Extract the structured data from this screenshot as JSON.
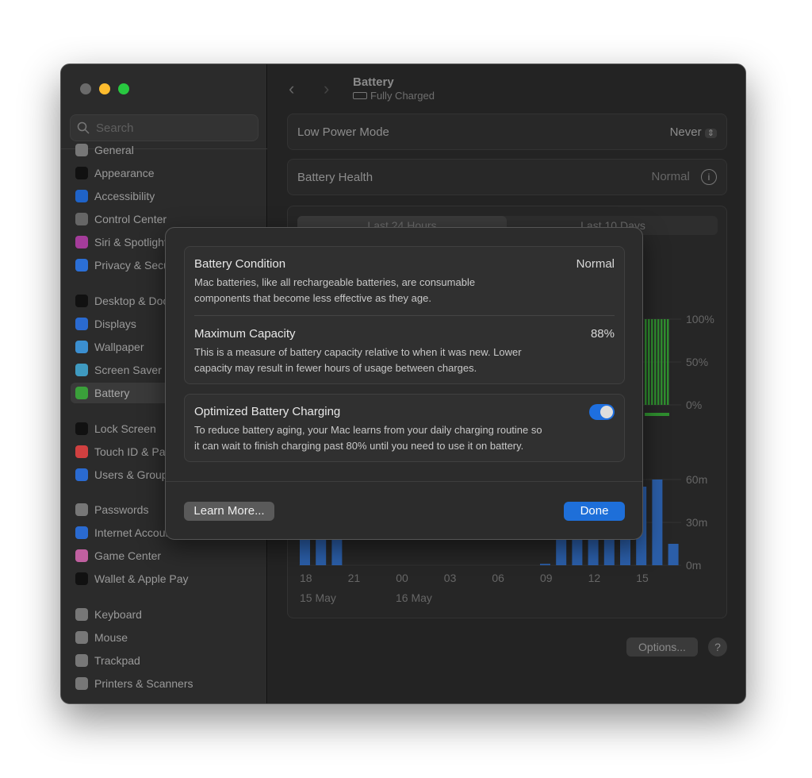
{
  "window": {
    "title": "Battery",
    "status": "Fully Charged"
  },
  "sidebar": {
    "search_placeholder": "Search",
    "items": [
      {
        "label": "General",
        "color": "#777"
      },
      {
        "label": "Appearance",
        "color": "#111"
      },
      {
        "label": "Accessibility",
        "color": "#1f63c8"
      },
      {
        "label": "Control Center",
        "color": "#666"
      },
      {
        "label": "Siri & Spotlight",
        "color": "#a43c9a"
      },
      {
        "label": "Privacy & Security",
        "color": "#2b6fd6"
      },
      {
        "label": "Desktop & Dock",
        "color": "#111"
      },
      {
        "label": "Displays",
        "color": "#2a6ad0"
      },
      {
        "label": "Wallpaper",
        "color": "#3b8fd0"
      },
      {
        "label": "Screen Saver",
        "color": "#3f9ac0"
      },
      {
        "label": "Battery",
        "color": "#3aa03a",
        "selected": true
      },
      {
        "label": "Lock Screen",
        "color": "#111"
      },
      {
        "label": "Touch ID & Password",
        "color": "#d04040"
      },
      {
        "label": "Users & Groups",
        "color": "#2a6ad0"
      },
      {
        "label": "Passwords",
        "color": "#777"
      },
      {
        "label": "Internet Accounts",
        "color": "#2a6ad0"
      },
      {
        "label": "Game Center",
        "color": "#c060a0"
      },
      {
        "label": "Wallet & Apple Pay",
        "color": "#111"
      },
      {
        "label": "Keyboard",
        "color": "#777"
      },
      {
        "label": "Mouse",
        "color": "#777"
      },
      {
        "label": "Trackpad",
        "color": "#777"
      },
      {
        "label": "Printers & Scanners",
        "color": "#777"
      }
    ]
  },
  "main": {
    "low_power_mode": {
      "label": "Low Power Mode",
      "value": "Never"
    },
    "battery_health": {
      "label": "Battery Health",
      "value": "Normal"
    },
    "tabs": [
      "Last 24 Hours",
      "Last 10 Days"
    ],
    "level_ticks": [
      "100%",
      "50%",
      "0%"
    ],
    "usage_ticks": [
      "60m",
      "30m",
      "0m"
    ],
    "x_ticks": [
      "18",
      "21",
      "00",
      "03",
      "06",
      "09",
      "12",
      "15"
    ],
    "date_labels": [
      "15 May",
      "16 May"
    ],
    "options_label": "Options...",
    "help_label": "?"
  },
  "chart_data": {
    "type": "bar",
    "x": [
      "18",
      "19",
      "20",
      "21",
      "22",
      "23",
      "00",
      "01",
      "02",
      "03",
      "04",
      "05",
      "06",
      "07",
      "08",
      "09",
      "10",
      "11",
      "12",
      "13",
      "14",
      "15",
      "16",
      "17"
    ],
    "usage_minutes": [
      30,
      30,
      30,
      0,
      0,
      0,
      0,
      0,
      0,
      0,
      0,
      0,
      0,
      0,
      0,
      1,
      40,
      45,
      40,
      50,
      45,
      55,
      60,
      15
    ],
    "ylim": [
      0,
      60
    ],
    "accent": "#2b5ea8",
    "level_color": "#2f8f2f"
  },
  "dialog": {
    "condition": {
      "title": "Battery Condition",
      "value": "Normal",
      "desc": [
        "Mac batteries, like all rechargeable batteries, are consumable",
        "components that become less effective as they age."
      ]
    },
    "capacity": {
      "title": "Maximum Capacity",
      "value": "88%",
      "desc": [
        "This is a measure of battery capacity relative to when it was new. Lower",
        "capacity may result in fewer hours of usage between charges."
      ]
    },
    "optimized": {
      "title": "Optimized Battery Charging",
      "enabled": true,
      "desc": [
        "To reduce battery aging, your Mac learns from your daily charging routine so",
        "it can wait to finish charging past 80% until you need to use it on battery."
      ]
    },
    "learn_more": "Learn More...",
    "done": "Done"
  }
}
